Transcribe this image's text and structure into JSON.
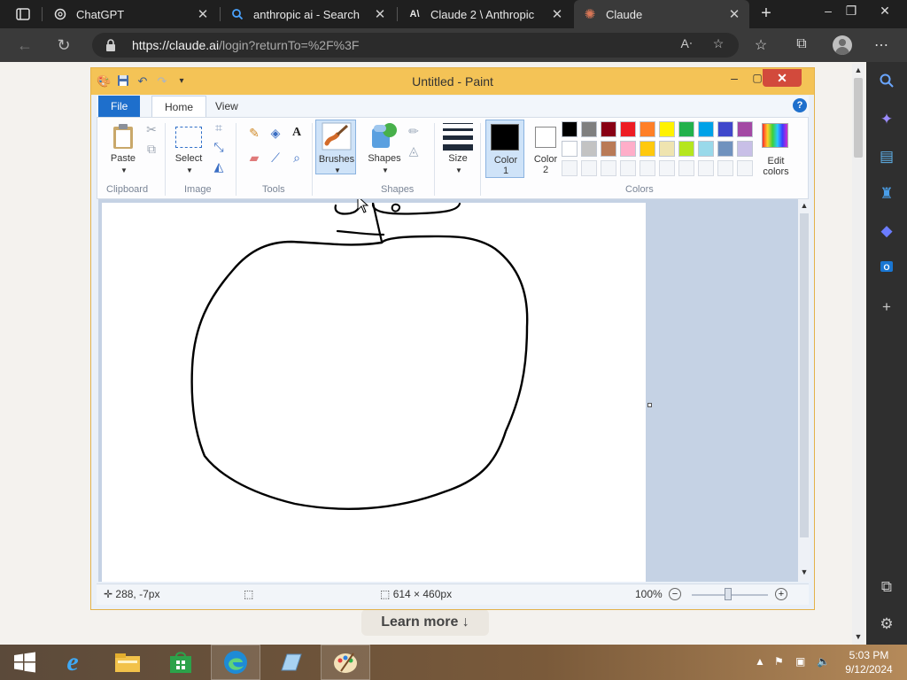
{
  "browser": {
    "tabs": [
      {
        "title": "ChatGPT",
        "icon": "chatgpt-icon"
      },
      {
        "title": "anthropic ai - Search",
        "icon": "search-icon"
      },
      {
        "title": "Claude 2 \\ Anthropic",
        "icon": "anthropic-icon"
      },
      {
        "title": "Claude",
        "icon": "claude-icon",
        "active": true
      }
    ],
    "url_host": "https://claude.ai",
    "url_path": "/login?returnTo=%2F%3F"
  },
  "page": {
    "learn_more": "Learn more ↓"
  },
  "paint": {
    "title": "Untitled - Paint",
    "ribbon_tabs": [
      "File",
      "Home",
      "View"
    ],
    "groups": {
      "clipboard": "Clipboard",
      "image": "Image",
      "tools": "Tools",
      "shapes": "Shapes",
      "colors": "Colors"
    },
    "buttons": {
      "paste": "Paste",
      "select": "Select",
      "brushes": "Brushes",
      "shapes": "Shapes",
      "size": "Size",
      "color1": "Color",
      "color1_num": "1",
      "color2": "Color",
      "color2_num": "2",
      "edit_colors_1": "Edit",
      "edit_colors_2": "colors",
      "text_tool": "A"
    },
    "palette_row1": [
      "#000000",
      "#7f7f7f",
      "#880015",
      "#ed1c24",
      "#ff7f27",
      "#fff200",
      "#22b14c",
      "#00a2e8",
      "#3f48cc",
      "#a349a4"
    ],
    "palette_row2": [
      "#ffffff",
      "#c3c3c3",
      "#b97a57",
      "#ffaec9",
      "#ffc90e",
      "#efe4b0",
      "#b5e61d",
      "#99d9ea",
      "#7092be",
      "#c8bfe7"
    ],
    "color1_value": "#000000",
    "color2_value": "#ffffff",
    "status": {
      "cursor_pos": "288, -7px",
      "canvas_size": "614 × 460px",
      "zoom": "100%"
    }
  },
  "taskbar": {
    "time": "5:03 PM",
    "date": "9/12/2024"
  }
}
